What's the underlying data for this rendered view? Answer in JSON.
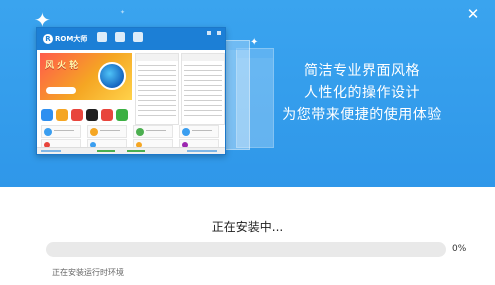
{
  "window": {
    "close_glyph": "✕",
    "accent_color": "#2f97e9"
  },
  "banner": {
    "slogan_lines": [
      "简洁专业界面风格",
      "人性化的操作设计",
      "为您带来便捷的使用体验"
    ]
  },
  "preview": {
    "logo_text": "ROM大师",
    "ad_text": "风 火 轮"
  },
  "install": {
    "title": "正在安装中...",
    "progress_percent": 0,
    "progress_label": "0%",
    "status": "正在安装运行时环境"
  }
}
